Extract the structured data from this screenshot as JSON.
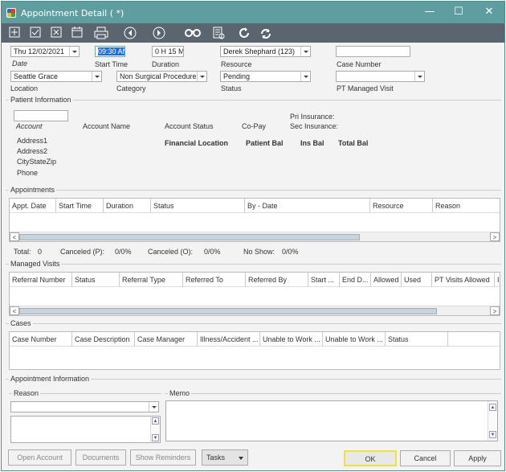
{
  "window": {
    "title": "Appointment Detail ( *)",
    "min": "—",
    "max": "☐",
    "close": "✕"
  },
  "toolbar": {
    "icons": [
      "add-icon",
      "check-icon",
      "cancel-icon",
      "calendar-icon",
      "print-icon",
      "prev-icon",
      "next-icon",
      "find-icon",
      "report-icon",
      "refresh-icon",
      "sync-icon"
    ]
  },
  "header": {
    "date": "Thu 12/02/2021",
    "date_label": "Date",
    "start_time": "09:30 AM",
    "start_label": "Start Time",
    "duration": "0 H 15 M",
    "duration_label": "Duration",
    "resource": "Derek Shephard  (123)",
    "resource_label": "Resource",
    "case_number": "",
    "case_label": "Case Number",
    "location": "Seattle Grace",
    "location_label": "Location",
    "category": "Non Surgical Procedure",
    "category_label": "Category",
    "status": "Pending",
    "status_label": "Status",
    "pt_managed": "",
    "pt_label": "PT Managed Visit"
  },
  "patient": {
    "group": "Patient Information",
    "account_label": "Account",
    "account_name": "Account Name",
    "account_status": "Account Status",
    "copay": "Co-Pay",
    "pri_ins": "Pri Insurance:",
    "sec_ins": "Sec Insurance:",
    "address1": "Address1",
    "address2": "Address2",
    "csz": "CityStateZip",
    "phone": "Phone",
    "fin_loc": "Financial Location",
    "pat_bal": "Patient Bal",
    "ins_bal": "Ins Bal",
    "total_bal": "Total Bal"
  },
  "appointments": {
    "group": "Appointments",
    "cols": [
      "Appt. Date",
      "Start Time",
      "Duration",
      "Status",
      "By - Date",
      "Resource",
      "Reason"
    ],
    "total": "Total:",
    "total_v": "0",
    "canc_p": "Canceled (P):",
    "canc_p_v": "0/0%",
    "canc_o": "Canceled (O):",
    "canc_o_v": "0/0%",
    "noshow": "No Show:",
    "noshow_v": "0/0%"
  },
  "managed": {
    "group": "Managed Visits",
    "cols": [
      "Referral Number",
      "Status",
      "Referral Type",
      "Referred To",
      "Referred By",
      "Start ...",
      "End D...",
      "Allowed",
      "Used",
      "PT Visits Allowed",
      "I"
    ]
  },
  "cases": {
    "group": "Cases",
    "cols": [
      "Case Number",
      "Case Description",
      "Case Manager",
      "Illness/Accident ...",
      "Unable to Work ...",
      "Unable to Work ...",
      "Status"
    ]
  },
  "appt_info": {
    "group": "Appointment Information",
    "reason": "Reason",
    "memo": "Memo"
  },
  "footer": {
    "open_account": "Open Account",
    "documents": "Documents",
    "show_reminders": "Show Reminders",
    "tasks": "Tasks",
    "ok": "OK",
    "cancel": "Cancel",
    "apply": "Apply"
  }
}
